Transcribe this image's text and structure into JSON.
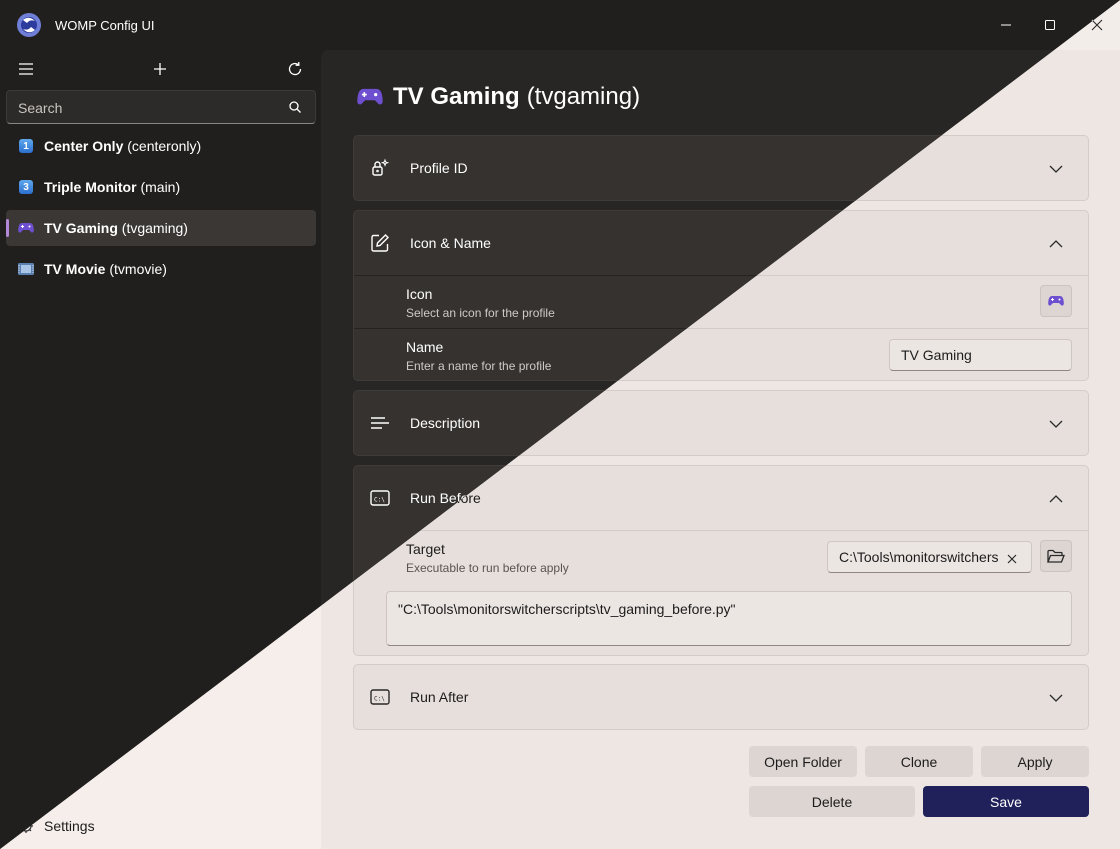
{
  "window": {
    "title": "WOMP Config UI"
  },
  "sidebar": {
    "search_placeholder": "Search",
    "items": [
      {
        "name": "Center Only",
        "id": "(centeronly)",
        "icon": "number-1-icon"
      },
      {
        "name": "Triple Monitor",
        "id": "(main)",
        "icon": "number-3-icon"
      },
      {
        "name": "TV Gaming",
        "id": "(tvgaming)",
        "icon": "gamepad-icon"
      },
      {
        "name": "TV Movie",
        "id": "(tvmovie)",
        "icon": "film-icon"
      }
    ],
    "number_badges": [
      "1",
      "3"
    ],
    "settings_label": "Settings"
  },
  "page": {
    "title_name": "TV Gaming",
    "title_id": "(tvgaming)"
  },
  "sections": {
    "profile_id": {
      "title": "Profile ID"
    },
    "icon_name": {
      "title": "Icon & Name",
      "icon_label": "Icon",
      "icon_desc": "Select an icon for the profile",
      "name_label": "Name",
      "name_desc": "Enter a name for the profile",
      "name_value": "TV Gaming"
    },
    "description": {
      "title": "Description"
    },
    "run_before": {
      "title": "Run Before",
      "target_label": "Target",
      "target_desc": "Executable to run before apply",
      "target_value": "C:\\Tools\\monitorswitchers",
      "args_value": "\"C:\\Tools\\monitorswitcherscripts\\tv_gaming_before.py\""
    },
    "run_after": {
      "title": "Run After"
    }
  },
  "actions": {
    "open_folder": "Open Folder",
    "clone": "Clone",
    "apply": "Apply",
    "delete": "Delete",
    "save": "Save"
  },
  "colors": {
    "accent": "#20205a",
    "selection_indicator": "#b388d6",
    "dark_bg": "#201f1d",
    "light_bg": "#f3ede9"
  }
}
